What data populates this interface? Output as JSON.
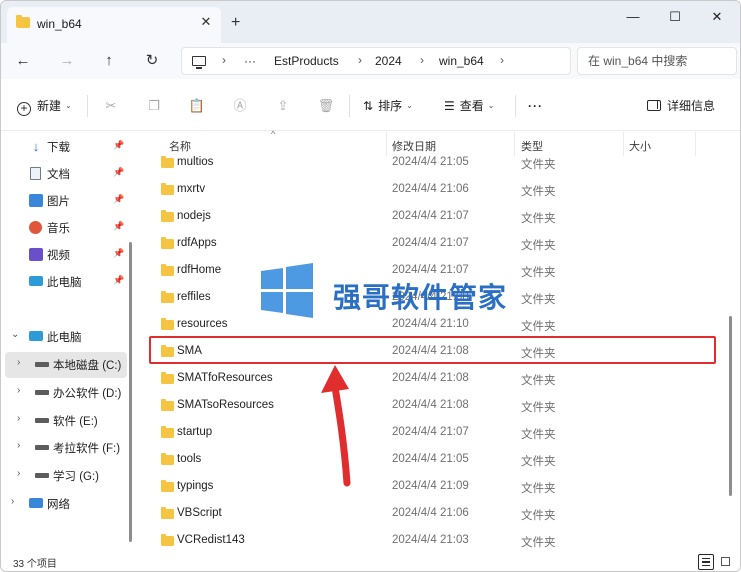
{
  "tab": {
    "title": "win_b64",
    "close": "✕",
    "new_tab": "+"
  },
  "window_controls": {
    "minimize": "—",
    "maximize": "☐",
    "close": "✕"
  },
  "address": {
    "more": "···",
    "crumbs": [
      "EstProducts",
      "2024",
      "win_b64"
    ],
    "search_placeholder": "在 win_b64 中搜索"
  },
  "toolbar": {
    "new": "新建",
    "sort": "排序",
    "view": "查看",
    "more": "···",
    "details": "详细信息"
  },
  "nav": {
    "quick": [
      {
        "label": "下载",
        "icon": "download-icon"
      },
      {
        "label": "文档",
        "icon": "document-icon"
      },
      {
        "label": "图片",
        "icon": "pictures-icon"
      },
      {
        "label": "音乐",
        "icon": "music-icon"
      },
      {
        "label": "视频",
        "icon": "video-icon"
      },
      {
        "label": "此电脑",
        "icon": "this-pc-icon"
      }
    ],
    "tree": {
      "root": "此电脑",
      "drives": [
        {
          "label": "本地磁盘 (C:)",
          "selected": true
        },
        {
          "label": "办公软件 (D:)",
          "selected": false
        },
        {
          "label": "软件 (E:)",
          "selected": false
        },
        {
          "label": "考拉软件 (F:)",
          "selected": false
        },
        {
          "label": "学习 (G:)",
          "selected": false
        }
      ],
      "network": "网络"
    }
  },
  "columns": {
    "name": "名称",
    "date": "修改日期",
    "type": "类型",
    "size": "大小"
  },
  "files": [
    {
      "name": "multios",
      "date": "2024/4/4 21:05",
      "type": "文件夹"
    },
    {
      "name": "mxrtv",
      "date": "2024/4/4 21:06",
      "type": "文件夹"
    },
    {
      "name": "nodejs",
      "date": "2024/4/4 21:07",
      "type": "文件夹"
    },
    {
      "name": "rdfApps",
      "date": "2024/4/4 21:07",
      "type": "文件夹"
    },
    {
      "name": "rdfHome",
      "date": "2024/4/4 21:07",
      "type": "文件夹"
    },
    {
      "name": "reffiles",
      "date": "2024/4/4 21:08",
      "type": "文件夹"
    },
    {
      "name": "resources",
      "date": "2024/4/4 21:10",
      "type": "文件夹"
    },
    {
      "name": "SMA",
      "date": "2024/4/4 21:08",
      "type": "文件夹"
    },
    {
      "name": "SMATfoResources",
      "date": "2024/4/4 21:08",
      "type": "文件夹"
    },
    {
      "name": "SMATsoResources",
      "date": "2024/4/4 21:08",
      "type": "文件夹"
    },
    {
      "name": "startup",
      "date": "2024/4/4 21:07",
      "type": "文件夹"
    },
    {
      "name": "tools",
      "date": "2024/4/4 21:05",
      "type": "文件夹"
    },
    {
      "name": "typings",
      "date": "2024/4/4 21:09",
      "type": "文件夹"
    },
    {
      "name": "VBScript",
      "date": "2024/4/4 21:06",
      "type": "文件夹"
    },
    {
      "name": "VCRedist143",
      "date": "2024/4/4 21:03",
      "type": "文件夹"
    }
  ],
  "status": {
    "count": "33 个项目"
  },
  "watermark": {
    "text": "强哥软件管家"
  },
  "colors": {
    "highlight": "#e02d2d",
    "arrow": "#e02d2d",
    "folder": "#f6c443",
    "watermark": "#2a6fc4"
  }
}
